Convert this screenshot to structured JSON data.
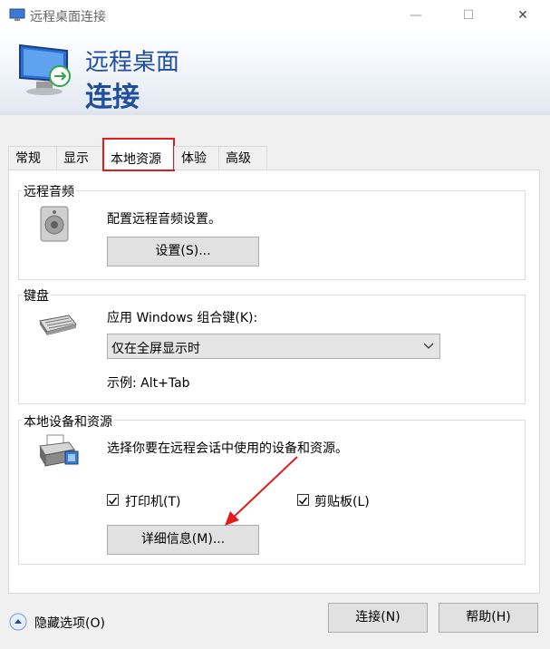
{
  "window": {
    "title": "远程桌面连接",
    "minimize_glyph": "—",
    "maximize_glyph": "☐",
    "close_glyph": "✕"
  },
  "banner": {
    "line1": "远程桌面",
    "line2": "连接"
  },
  "tabs": [
    {
      "label": "常规"
    },
    {
      "label": "显示"
    },
    {
      "label": "本地资源",
      "active": true
    },
    {
      "label": "体验"
    },
    {
      "label": "高级"
    }
  ],
  "audio": {
    "group_label": "远程音频",
    "description": "配置远程音频设置。",
    "settings_button": "设置(S)..."
  },
  "keyboard": {
    "group_label": "键盘",
    "apply_label": "应用 Windows 组合键(K):",
    "selected_option": "仅在全屏显示时",
    "example": "示例: Alt+Tab"
  },
  "devices": {
    "group_label": "本地设备和资源",
    "description": "选择你要在远程会话中使用的设备和资源。",
    "printer_label": "打印机(T)",
    "printer_checked": true,
    "clipboard_label": "剪贴板(L)",
    "clipboard_checked": true,
    "details_button": "详细信息(M)..."
  },
  "footer": {
    "hide_options": "隐藏选项(O)",
    "connect_button": "连接(N)",
    "help_button": "帮助(H)"
  },
  "colors": {
    "banner_text": "#1f4e9c",
    "highlight": "#e21c1c"
  }
}
